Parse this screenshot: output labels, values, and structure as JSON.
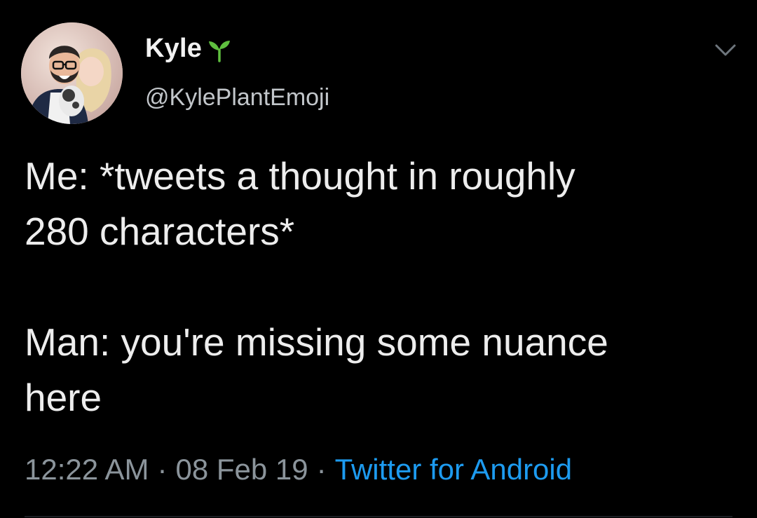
{
  "tweet": {
    "display_name": "Kyle",
    "name_icon": "seedling-icon",
    "handle": "@KylePlantEmoji",
    "text_lines": [
      "Me: *tweets a thought in roughly",
      "280 characters*",
      "Man: you're missing some nuance",
      "here"
    ],
    "time": "12:22 AM",
    "date": "08 Feb 19",
    "separator": "·",
    "source": "Twitter for Android",
    "menu_icon": "chevron-down-icon"
  },
  "colors": {
    "background": "#000000",
    "text": "#ededed",
    "secondary_text": "#8b949b",
    "link": "#1d9bf0",
    "plant_green": "#5fbf3f"
  }
}
